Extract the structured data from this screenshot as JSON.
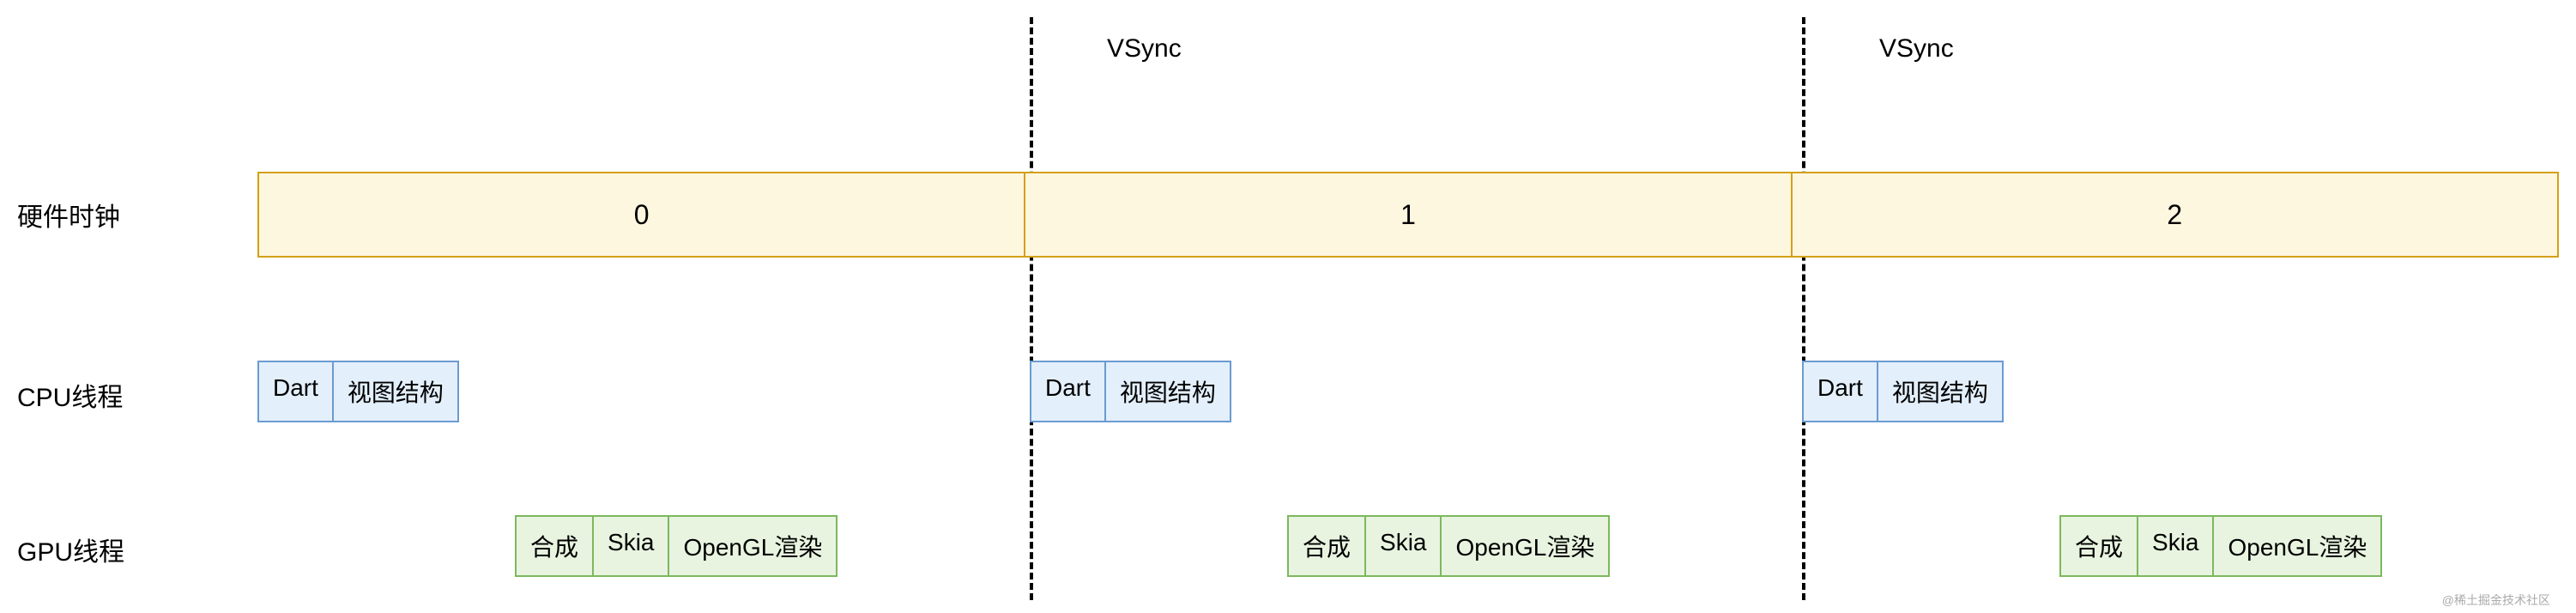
{
  "labels": {
    "hardware_clock": "硬件时钟",
    "cpu_thread": "CPU线程",
    "gpu_thread": "GPU线程",
    "vsync": "VSync"
  },
  "clock_frames": [
    "0",
    "1",
    "2"
  ],
  "cpu_stages": {
    "dart": "Dart",
    "view_tree": "视图结构"
  },
  "gpu_stages": {
    "composite": "合成",
    "skia": "Skia",
    "opengl": "OpenGL渲染"
  },
  "colors": {
    "clock_fill": "#fef7e0",
    "clock_border": "#d4a017",
    "cpu_fill": "#e3effb",
    "cpu_border": "#6b9bd1",
    "gpu_fill": "#e8f4e0",
    "gpu_border": "#7cb85e"
  },
  "watermark": "@稀土掘金技术社区"
}
